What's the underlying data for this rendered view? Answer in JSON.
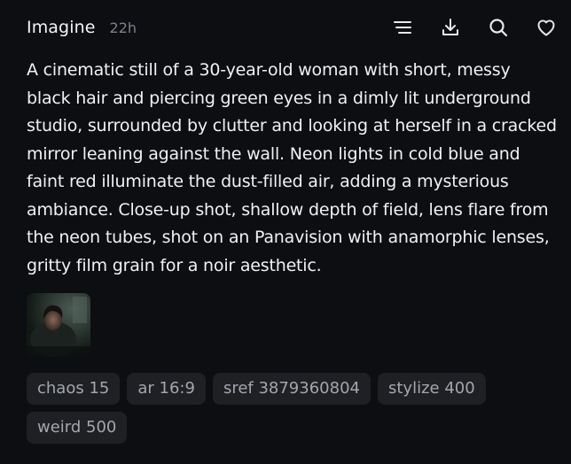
{
  "header": {
    "title": "Imagine",
    "time": "22h"
  },
  "icons": {
    "menu": "menu-lines-icon",
    "download": "download-icon",
    "search": "search-icon",
    "like": "heart-icon"
  },
  "prompt": {
    "text": "A cinematic still of a 30-year-old woman with short, messy black hair and piercing green eyes in a dimly lit underground studio, surrounded by clutter and looking at herself in a cracked mirror leaning against the wall. Neon lights in cold blue and faint red illuminate the dust-filled air, adding a mysterious ambiance. Close-up shot, shallow depth of field, lens flare from the neon tubes, shot on an Panavision with anamorphic lenses, gritty film grain for a noir aesthetic."
  },
  "tags": [
    {
      "label": "chaos 15"
    },
    {
      "label": "ar 16:9"
    },
    {
      "label": "sref 3879360804"
    },
    {
      "label": "stylize 400"
    },
    {
      "label": "weird 500"
    }
  ],
  "colors": {
    "background": "#0d0e11",
    "text": "#f2f2f3",
    "muted": "#7d808a",
    "tag_bg": "#1e2024",
    "tag_text": "#a3a6ad"
  }
}
